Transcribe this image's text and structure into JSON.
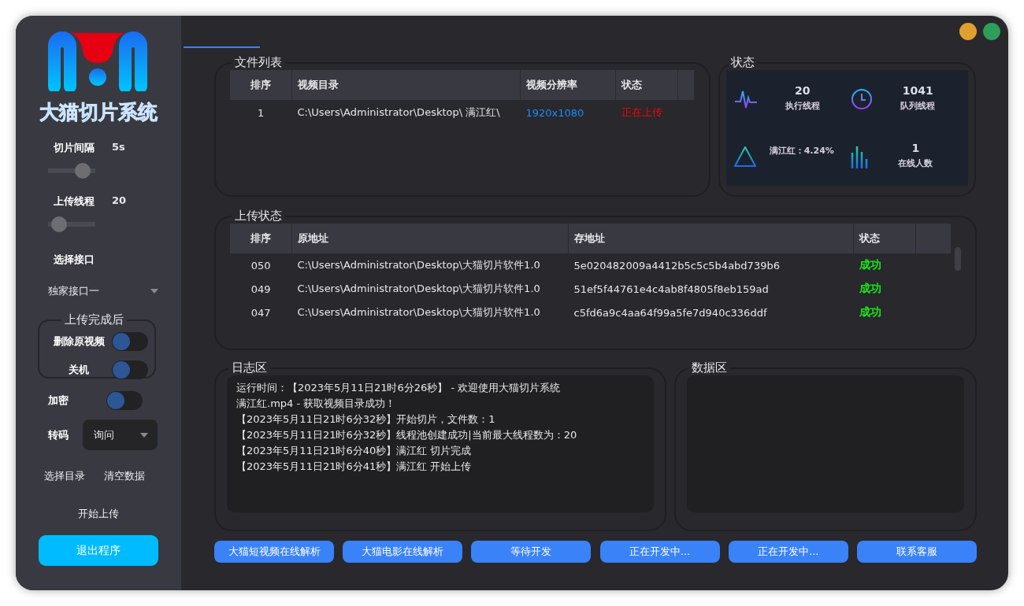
{
  "sidebar": {
    "app_title": "大猫切片系统",
    "sliders": [
      {
        "label": "切片间隔",
        "value": "5s",
        "level": 0.85
      },
      {
        "label": "上传线程",
        "value": "20",
        "level": 0.1
      }
    ],
    "interface": {
      "label": "选择接口",
      "value": "独家接口一"
    },
    "after_upload": {
      "title": "上传完成后",
      "toggles": [
        {
          "label": "删除原视频",
          "on": false
        },
        {
          "label": "关机",
          "on": false
        }
      ]
    },
    "encrypt": {
      "label": "加密",
      "on": false
    },
    "transcode": {
      "label": "转码",
      "value": "询问"
    },
    "actions": [
      "选择目录",
      "清空数据"
    ],
    "start": "开始上传",
    "exit": "退出程序"
  },
  "file_list": {
    "title": "文件列表",
    "columns": [
      "排序",
      "视频目录",
      "视频分辨率",
      "状态"
    ],
    "rows": [
      {
        "index": "1",
        "path": "C:\\Users\\Administrator\\Desktop\\ 满江红\\",
        "resolution": "1920x1080",
        "status": "正在上传",
        "color": "#ff0000"
      }
    ]
  },
  "status": {
    "title": "状态",
    "stats": [
      {
        "kind": "pulse",
        "value": "20",
        "label": "执行线程"
      },
      {
        "kind": "clock",
        "value": "1041",
        "label": "队列线程"
      },
      {
        "kind": "warning",
        "label": "满江红：4.24%"
      },
      {
        "kind": "bars",
        "value": "1",
        "label": "在线人数"
      }
    ]
  },
  "upload": {
    "title": "上传状态",
    "columns": [
      "排序",
      "原地址",
      "存地址",
      "状态"
    ],
    "rows": [
      {
        "index": "050",
        "source": "C:\\Users\\Administrator\\Desktop\\大猫切片软件1.0",
        "target": "5e020482009a4412b5c5c5b4abd739b6",
        "status": "成功",
        "color": "#19e619"
      },
      {
        "index": "049",
        "source": "C:\\Users\\Administrator\\Desktop\\大猫切片软件1.0",
        "target": "51ef5f44761e4c4ab8f4805f8eb159ad",
        "status": "成功",
        "color": "#19e619"
      },
      {
        "index": "047",
        "source": "C:\\Users\\Administrator\\Desktop\\大猫切片软件1.0",
        "target": "c5fd6a9c4aa64f99a5fe7d940c336ddf",
        "status": "成功",
        "color": "#19e619"
      }
    ]
  },
  "log": {
    "title": "日志区",
    "lines": [
      "运行时间：【2023年5月11日21时6分26秒】 - 欢迎使用大猫切片系统",
      "满江红.mp4 - 获取视频目录成功！",
      "【2023年5月11日21时6分32秒】开始切片，文件数：1",
      "【2023年5月11日21时6分32秒】线程池创建成功|当前最大线程数为：20",
      "【2023年5月11日21时6分40秒】满江红 切片完成",
      "【2023年5月11日21时6分41秒】满江红 开始上传"
    ]
  },
  "data_area": {
    "title": "数据区"
  },
  "buttons": [
    "大猫短视频在线解析",
    "大猫电影在线解析",
    "等待开发",
    "正在开发中...",
    "正在开发中...",
    "联系客服"
  ]
}
